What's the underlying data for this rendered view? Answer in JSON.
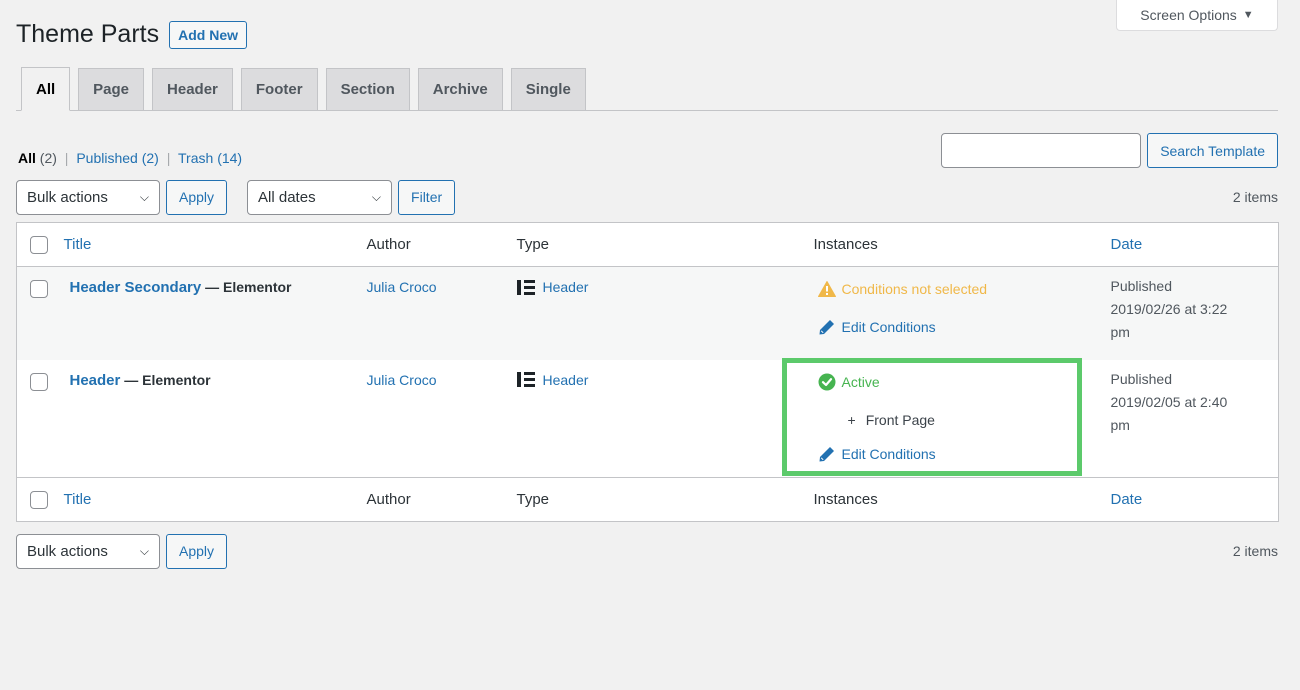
{
  "screen_options": {
    "label": "Screen Options",
    "caret": "▼"
  },
  "page": {
    "title": "Theme Parts",
    "add_new": "Add New"
  },
  "tabs": [
    {
      "label": "All",
      "active": true
    },
    {
      "label": "Page"
    },
    {
      "label": "Header"
    },
    {
      "label": "Footer"
    },
    {
      "label": "Section"
    },
    {
      "label": "Archive"
    },
    {
      "label": "Single"
    }
  ],
  "views": {
    "all": {
      "label": "All",
      "count": "(2)"
    },
    "published": {
      "label": "Published",
      "count": "(2)"
    },
    "trash": {
      "label": "Trash",
      "count": "(14)"
    },
    "separator": "|"
  },
  "search": {
    "value": "",
    "placeholder": "",
    "button": "Search Template"
  },
  "tablenav_top": {
    "bulk_actions": "Bulk actions",
    "apply": "Apply",
    "dates": "All dates",
    "filter": "Filter",
    "items": "2 items"
  },
  "tablenav_bottom": {
    "bulk_actions": "Bulk actions",
    "apply": "Apply",
    "items": "2 items"
  },
  "table": {
    "columns": {
      "title": "Title",
      "author": "Author",
      "type": "Type",
      "instances": "Instances",
      "date": "Date"
    },
    "rows": [
      {
        "title": "Header Secondary",
        "suffix": " — Elementor",
        "author": "Julia Croco",
        "type": "Header",
        "type_icon": "elementor-icon",
        "status_icon": "warning-icon",
        "status": "Conditions not selected",
        "edit": "Edit Conditions",
        "date_status": "Published",
        "date": "2019/02/26 at 3:22 pm"
      },
      {
        "title": "Header",
        "suffix": " — Elementor",
        "author": "Julia Croco",
        "type": "Header",
        "type_icon": "elementor-icon",
        "status_icon": "check-circle-icon",
        "status": "Active",
        "condition_prefix": "+",
        "condition": "Front Page",
        "edit": "Edit Conditions",
        "date_status": "Published",
        "date": "2019/02/05 at 2:40 pm",
        "highlighted": true
      }
    ]
  },
  "colors": {
    "link": "#2271b1",
    "warning": "#f0b849",
    "active": "#46b450",
    "highlight_border": "#5cca6b"
  }
}
